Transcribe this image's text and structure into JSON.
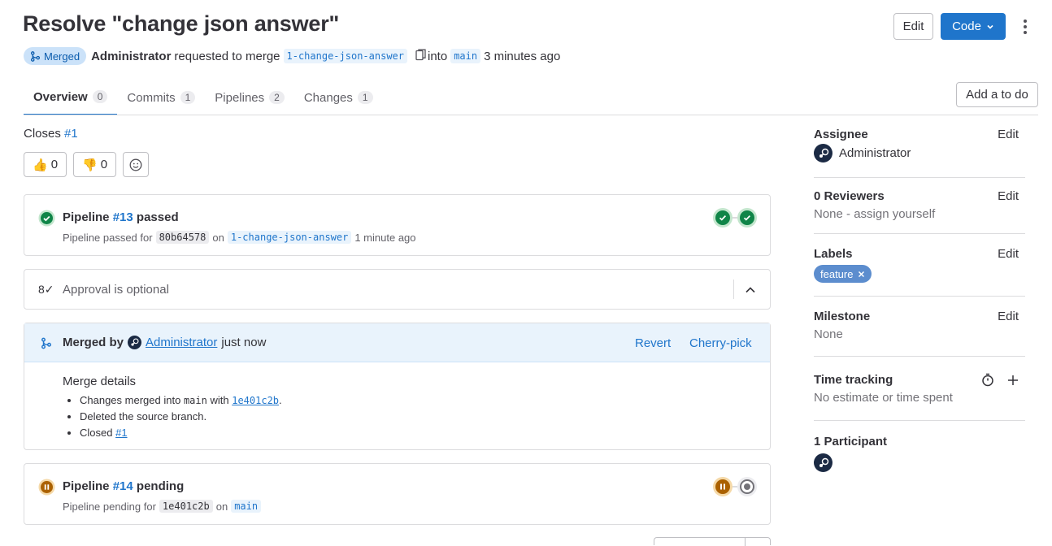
{
  "header": {
    "title": "Resolve \"change json answer\"",
    "status_badge": "Merged",
    "author": "Administrator",
    "requested_text": "requested to merge",
    "source_branch": "1-change-json-answer",
    "into_text": "into",
    "target_branch": "main",
    "time_ago": "3 minutes ago",
    "edit_label": "Edit",
    "code_label": "Code"
  },
  "tabs": [
    {
      "label": "Overview",
      "count": "0"
    },
    {
      "label": "Commits",
      "count": "1"
    },
    {
      "label": "Pipelines",
      "count": "2"
    },
    {
      "label": "Changes",
      "count": "1"
    }
  ],
  "todo_label": "Add a to do",
  "closes": {
    "text": "Closes",
    "issue": "#1"
  },
  "reactions": {
    "thumbs_up": "0",
    "thumbs_down": "0"
  },
  "pipeline_top": {
    "prefix": "Pipeline",
    "id": "#13",
    "status": "passed",
    "sub_prefix": "Pipeline passed for",
    "sha": "80b64578",
    "on_text": "on",
    "branch": "1-change-json-answer",
    "time": "1 minute ago"
  },
  "approval": {
    "text": "Approval is optional",
    "icon": "8✓"
  },
  "merged_by": {
    "prefix": "Merged by",
    "user": "Administrator",
    "time": "just now",
    "revert_label": "Revert",
    "cherry_pick_label": "Cherry-pick"
  },
  "merge_details": {
    "title": "Merge details",
    "item1_prefix": "Changes merged into",
    "item1_branch": "main",
    "item1_with": "with",
    "item1_sha": "1e401c2b",
    "item1_suffix": ".",
    "item2": "Deleted the source branch.",
    "item3_prefix": "Closed",
    "item3_issue": "#1"
  },
  "pipeline_bottom": {
    "prefix": "Pipeline",
    "id": "#14",
    "status": "pending",
    "sub_prefix": "Pipeline pending for",
    "sha": "1e401c2b",
    "on_text": "on",
    "branch": "main"
  },
  "sidebar": {
    "assignee": {
      "title": "Assignee",
      "edit": "Edit",
      "name": "Administrator"
    },
    "reviewers": {
      "title": "0 Reviewers",
      "edit": "Edit",
      "value": "None - assign yourself"
    },
    "labels": {
      "title": "Labels",
      "edit": "Edit",
      "label": "feature",
      "label_color": "#5c8dce"
    },
    "milestone": {
      "title": "Milestone",
      "edit": "Edit",
      "value": "None"
    },
    "time_tracking": {
      "title": "Time tracking",
      "value": "No estimate or time spent"
    },
    "participants": {
      "title": "1 Participant"
    }
  },
  "colors": {
    "accent": "#1f75cb",
    "success": "#108548",
    "pending": "#ab6100",
    "merged_bg": "#cbe2f9"
  }
}
